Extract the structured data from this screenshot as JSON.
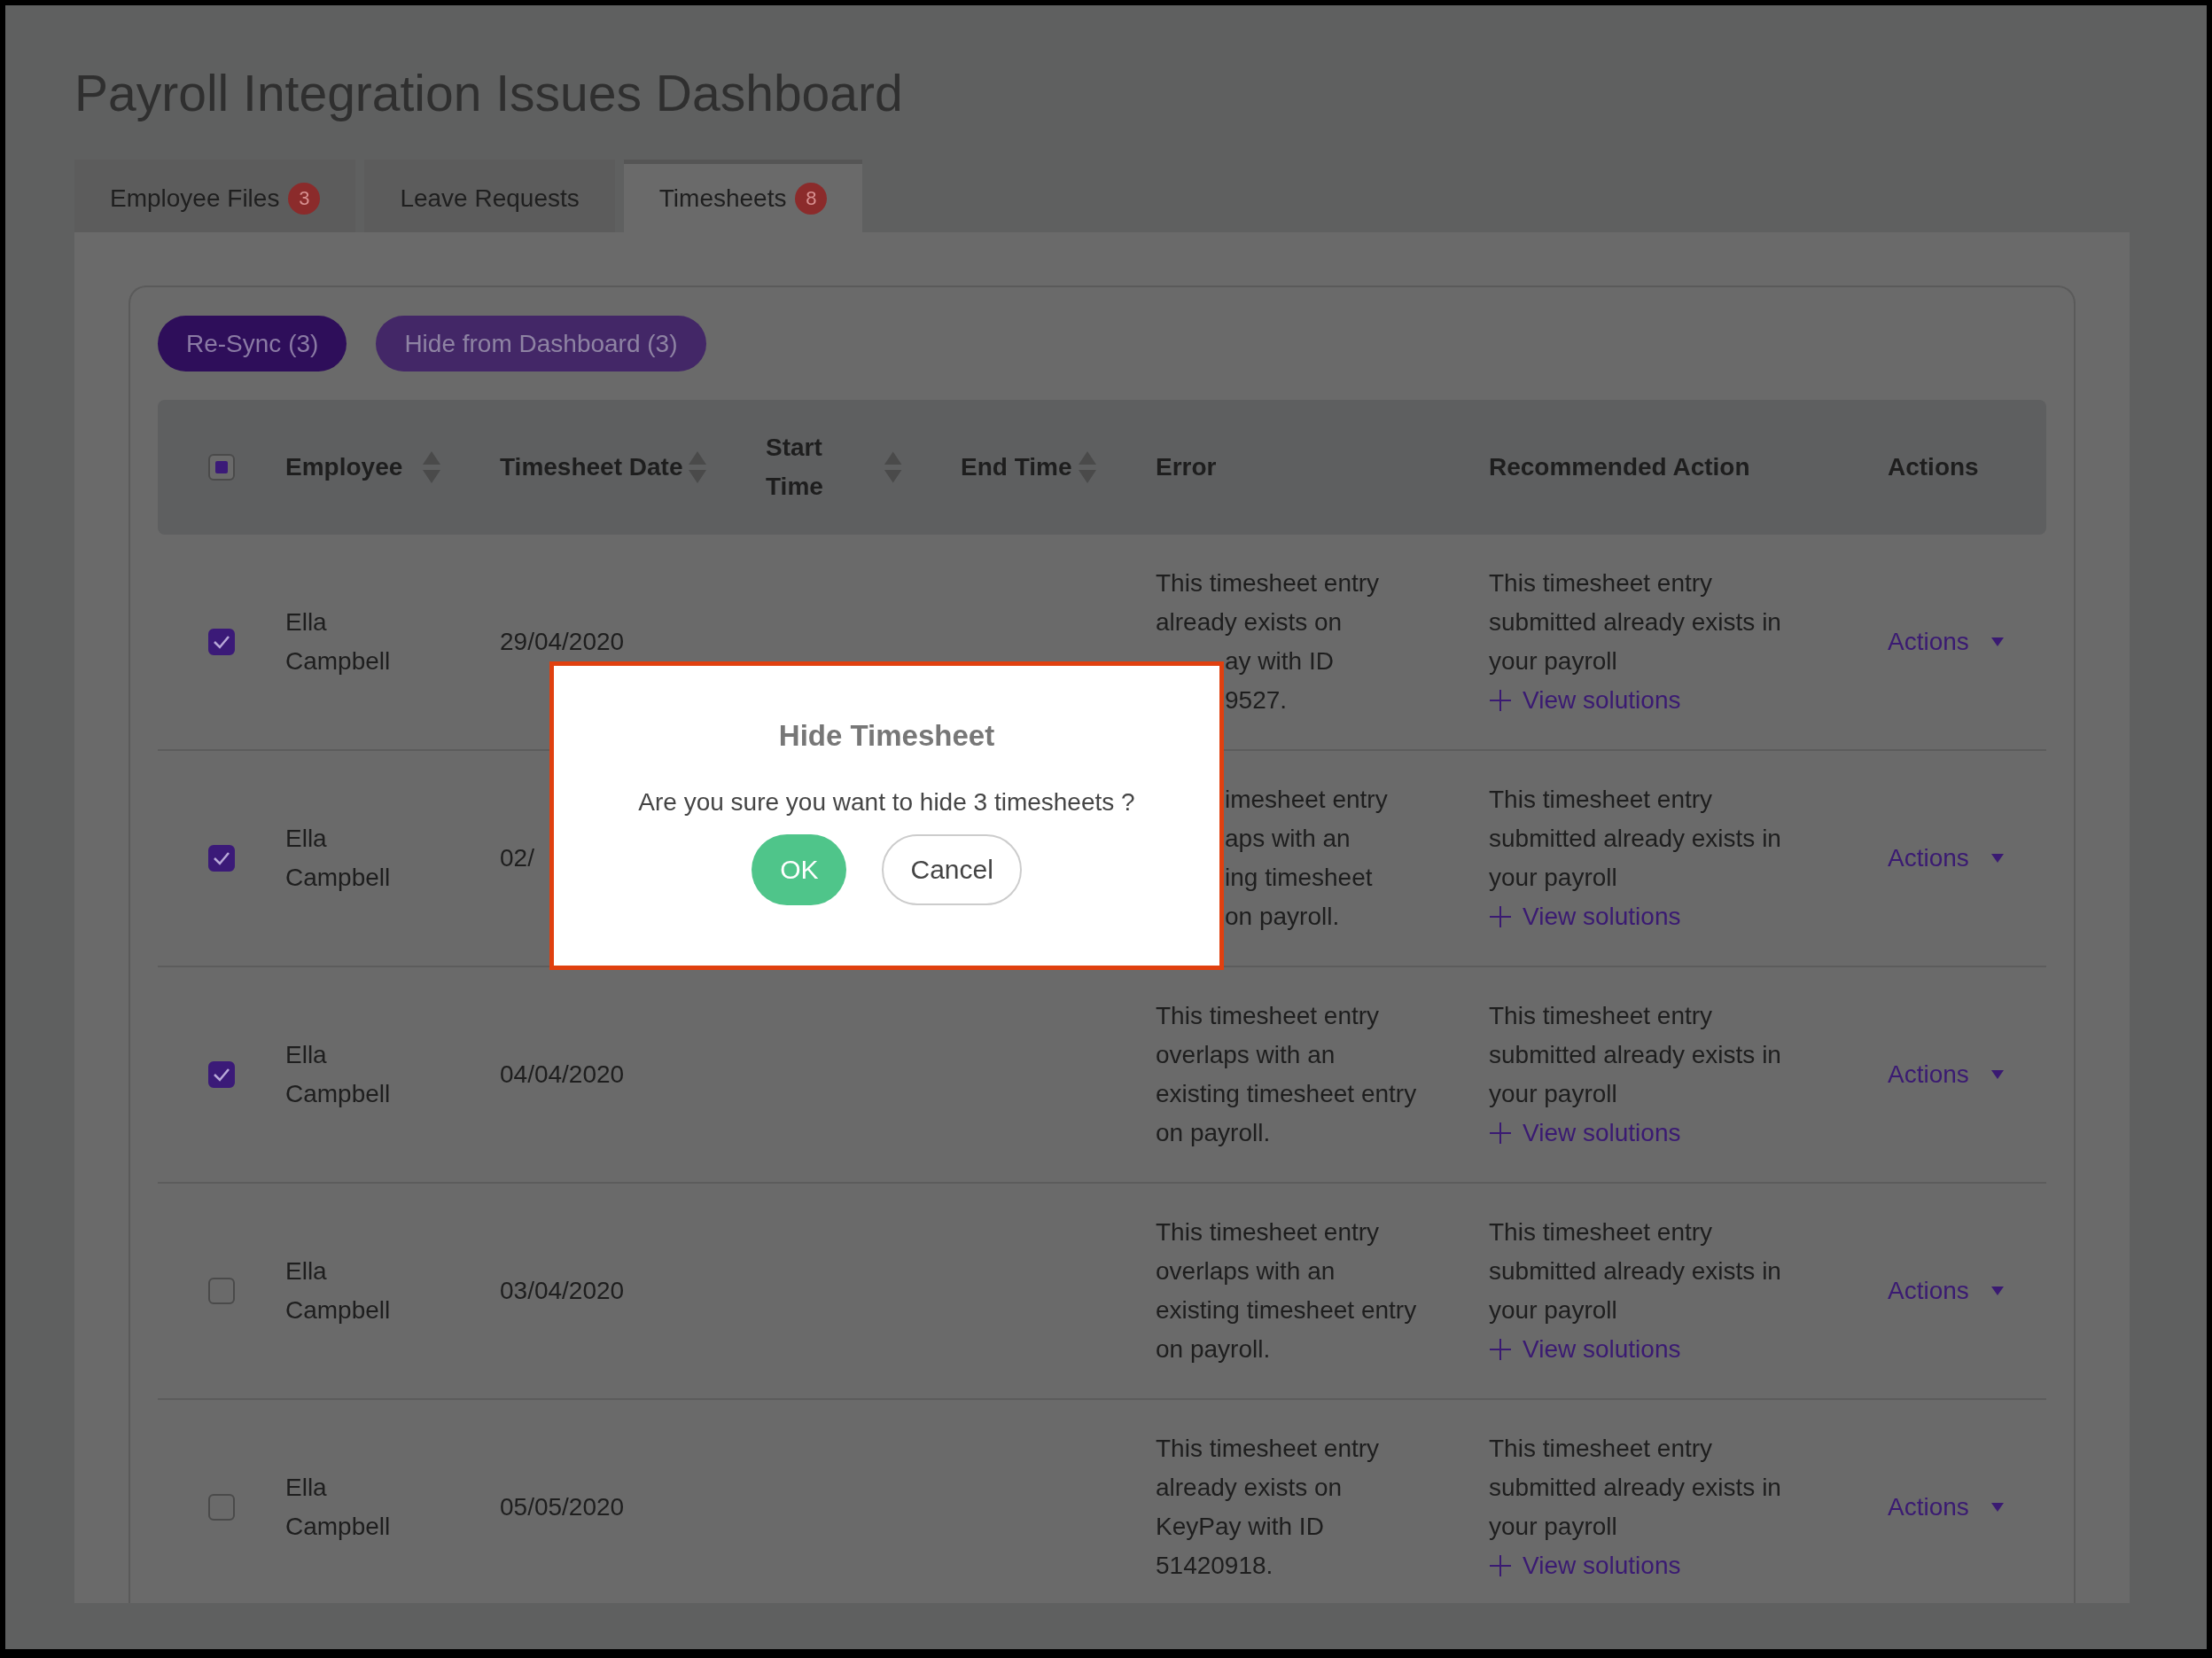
{
  "title": "Payroll Integration Issues Dashboard",
  "tabs": [
    {
      "label": "Employee Files",
      "badge": "3",
      "selected": false
    },
    {
      "label": "Leave Requests",
      "selected": false
    },
    {
      "label": "Timesheets",
      "badge": "8",
      "selected": true
    }
  ],
  "toolbar": [
    {
      "label": "Re-Sync (3)",
      "kind": "primary"
    },
    {
      "label": "Hide from Dashboard (3)",
      "kind": "secondary"
    }
  ],
  "table": {
    "select_all": {
      "checked": false,
      "indeterminate": true
    },
    "columns": [
      {
        "label": "Employee",
        "sortable": true
      },
      {
        "label": "Timesheet Date",
        "sortable": true
      },
      {
        "label": "Start Time",
        "sortable": true
      },
      {
        "label": "End Time",
        "sortable": true
      },
      {
        "label": "Error",
        "sortable": false
      },
      {
        "label": "Recommended Action",
        "sortable": false
      },
      {
        "label": "Actions",
        "sortable": false
      }
    ],
    "rows": [
      {
        "checked": true,
        "employee": "Ella Campbell",
        "date": "29/04/2020",
        "error": [
          {
            "text": "This timesheet entry",
            "cut": false
          },
          {
            "text": "already exists on",
            "cut": false
          },
          {
            "text": "ay with ID",
            "cut": true
          },
          {
            "text": "9527.",
            "cut": true
          }
        ],
        "recommendation": "This timesheet entry submitted already exists in your payroll",
        "link": "View solutions",
        "action": "Actions"
      },
      {
        "checked": true,
        "employee": "Ella Campbell",
        "date": "02/",
        "error": [
          {
            "text": "imesheet entry",
            "cut": true
          },
          {
            "text": "aps with an",
            "cut": true
          },
          {
            "text": "ing timesheet",
            "cut": true
          },
          {
            "text": "on payroll.",
            "cut": true
          }
        ],
        "recommendation": "This timesheet entry submitted already exists in your payroll",
        "link": "View solutions",
        "action": "Actions"
      },
      {
        "checked": true,
        "employee": "Ella Campbell",
        "date": "04/04/2020",
        "error": [
          {
            "text": "This timesheet entry overlaps with an existing timesheet entry on payroll.",
            "cut": false
          }
        ],
        "recommendation": "This timesheet entry submitted already exists in your payroll",
        "link": "View solutions",
        "action": "Actions"
      },
      {
        "checked": false,
        "employee": "Ella Campbell",
        "date": "03/04/2020",
        "error": [
          {
            "text": "This timesheet entry overlaps with an existing timesheet entry on payroll.",
            "cut": false
          }
        ],
        "recommendation": "This timesheet entry submitted already exists in your payroll",
        "link": "View solutions",
        "action": "Actions"
      },
      {
        "checked": false,
        "employee": "Ella Campbell",
        "date": "05/05/2020",
        "error": [
          {
            "text": "This timesheet entry already exists on KeyPay with ID 51420918.",
            "cut": false
          }
        ],
        "recommendation": "This timesheet entry submitted already exists in your payroll",
        "link": "View solutions",
        "action": "Actions"
      }
    ]
  },
  "dialog": {
    "title": "Hide Timesheet",
    "message": "Are you sure you want to hide 3 timesheets ?",
    "buttons": [
      {
        "label": "OK",
        "kind": "confirm"
      },
      {
        "label": "Cancel",
        "kind": "cancel"
      }
    ]
  }
}
